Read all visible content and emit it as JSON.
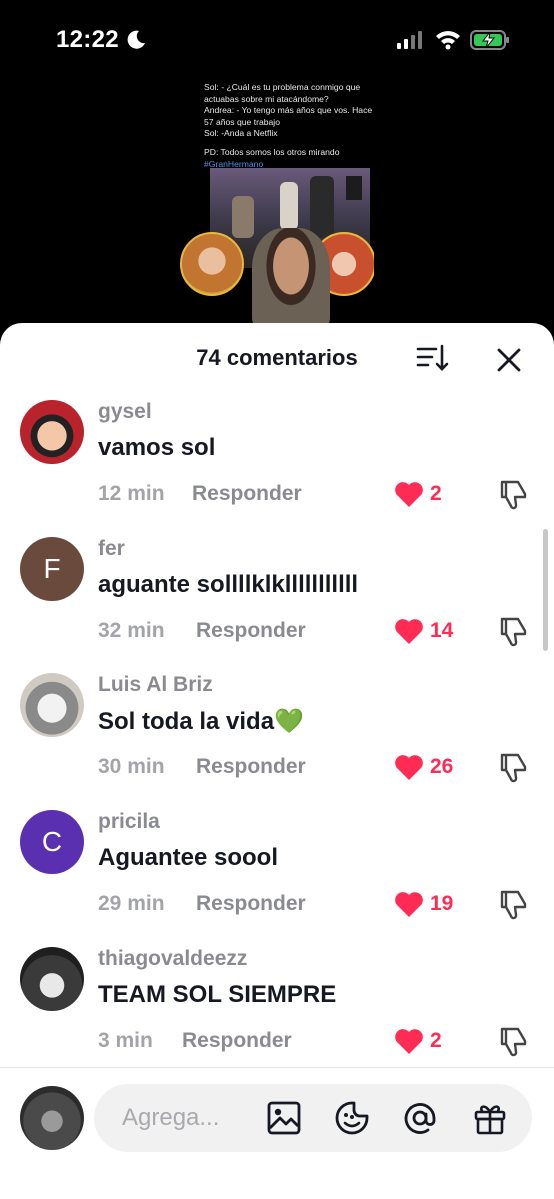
{
  "status_bar": {
    "time": "12:22"
  },
  "video": {
    "post_lines": [
      "Sol: - ¿Cuál es tu problema conmigo que actuabas sobre mi atacándome?\nAndrea: - Yo tengo más años que vos. Hace 57 años que trabajo\nSol: -Anda a Netflix",
      "PD: Todos somos los otros mirando"
    ],
    "hashtag": "#GranHermano"
  },
  "sheet": {
    "title": "74 comentarios"
  },
  "comments": [
    {
      "username": "gysel",
      "text": "vamos sol",
      "time": "12 min",
      "reply": "Responder",
      "likes": "2",
      "avatar_letter": "",
      "avatar_color": "#f2c4a5"
    },
    {
      "username": "fer",
      "text": "aguante sollllklklllllllllll",
      "time": "32 min",
      "reply": "Responder",
      "likes": "14",
      "avatar_letter": "F",
      "avatar_color": "#6b4a3e"
    },
    {
      "username": "Luis Al Briz",
      "text": "Sol toda la vida💚",
      "time": "30 min",
      "reply": "Responder",
      "likes": "26",
      "avatar_letter": "",
      "avatar_color": "#d8d4cc"
    },
    {
      "username": "pricila",
      "text": "Aguantee soool",
      "time": "29 min",
      "reply": "Responder",
      "likes": "19",
      "avatar_letter": "C",
      "avatar_color": "#5a2fb0"
    },
    {
      "username": "thiagovaldeezz",
      "text": "TEAM SOL SIEMPRE",
      "time": "3 min",
      "reply": "Responder",
      "likes": "2",
      "avatar_letter": "",
      "avatar_color": "#3a3a3a"
    }
  ],
  "input": {
    "placeholder": "Agrega..."
  },
  "colors": {
    "like": "#fe2c55",
    "text": "#161823",
    "muted": "#8a8b91"
  },
  "icons": [
    "moon-icon",
    "signal-icon",
    "wifi-icon",
    "battery-charging-icon",
    "sort-icon",
    "close-icon",
    "heart-icon",
    "dislike-icon",
    "image-icon",
    "emoji-icon",
    "mention-icon",
    "gift-icon"
  ]
}
